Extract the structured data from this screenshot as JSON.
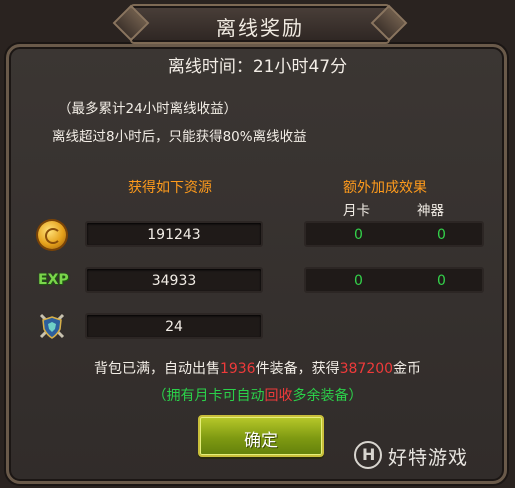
{
  "dialog": {
    "title": "离线奖励",
    "offline_time_label": "离线时间：21小时47分",
    "info_line1": "（最多累计24小时离线收益）",
    "info_line2": "离线超过8小时后，只能获得80%离线收益",
    "resources_header": "获得如下资源",
    "bonus_header": "额外加成效果",
    "bonus_col1": "月卡",
    "bonus_col2": "神器",
    "rows": [
      {
        "icon": "gold-coin-icon",
        "value": "191243",
        "bonus_yueka": "0",
        "bonus_shenqi": "0"
      },
      {
        "icon": "exp-icon",
        "icon_text": "EXP",
        "value": "34933",
        "bonus_yueka": "0",
        "bonus_shenqi": "0"
      },
      {
        "icon": "equipment-icon",
        "value": "24"
      }
    ],
    "notice": {
      "prefix": "背包已满，自动出售",
      "sold_count": "1936",
      "middle": "件装备，获得",
      "gold_amount": "387200",
      "suffix": "金币"
    },
    "hint": {
      "open": "（拥有月卡可自动",
      "highlight": "回收",
      "close": "多余装备）"
    },
    "confirm_label": "确定"
  },
  "watermark": {
    "text": "好特游戏"
  },
  "colors": {
    "orange_header": "#ff9b1c",
    "green_value": "#33d24a",
    "red_value": "#ee3a3a",
    "button_green": "#7f9a12"
  }
}
